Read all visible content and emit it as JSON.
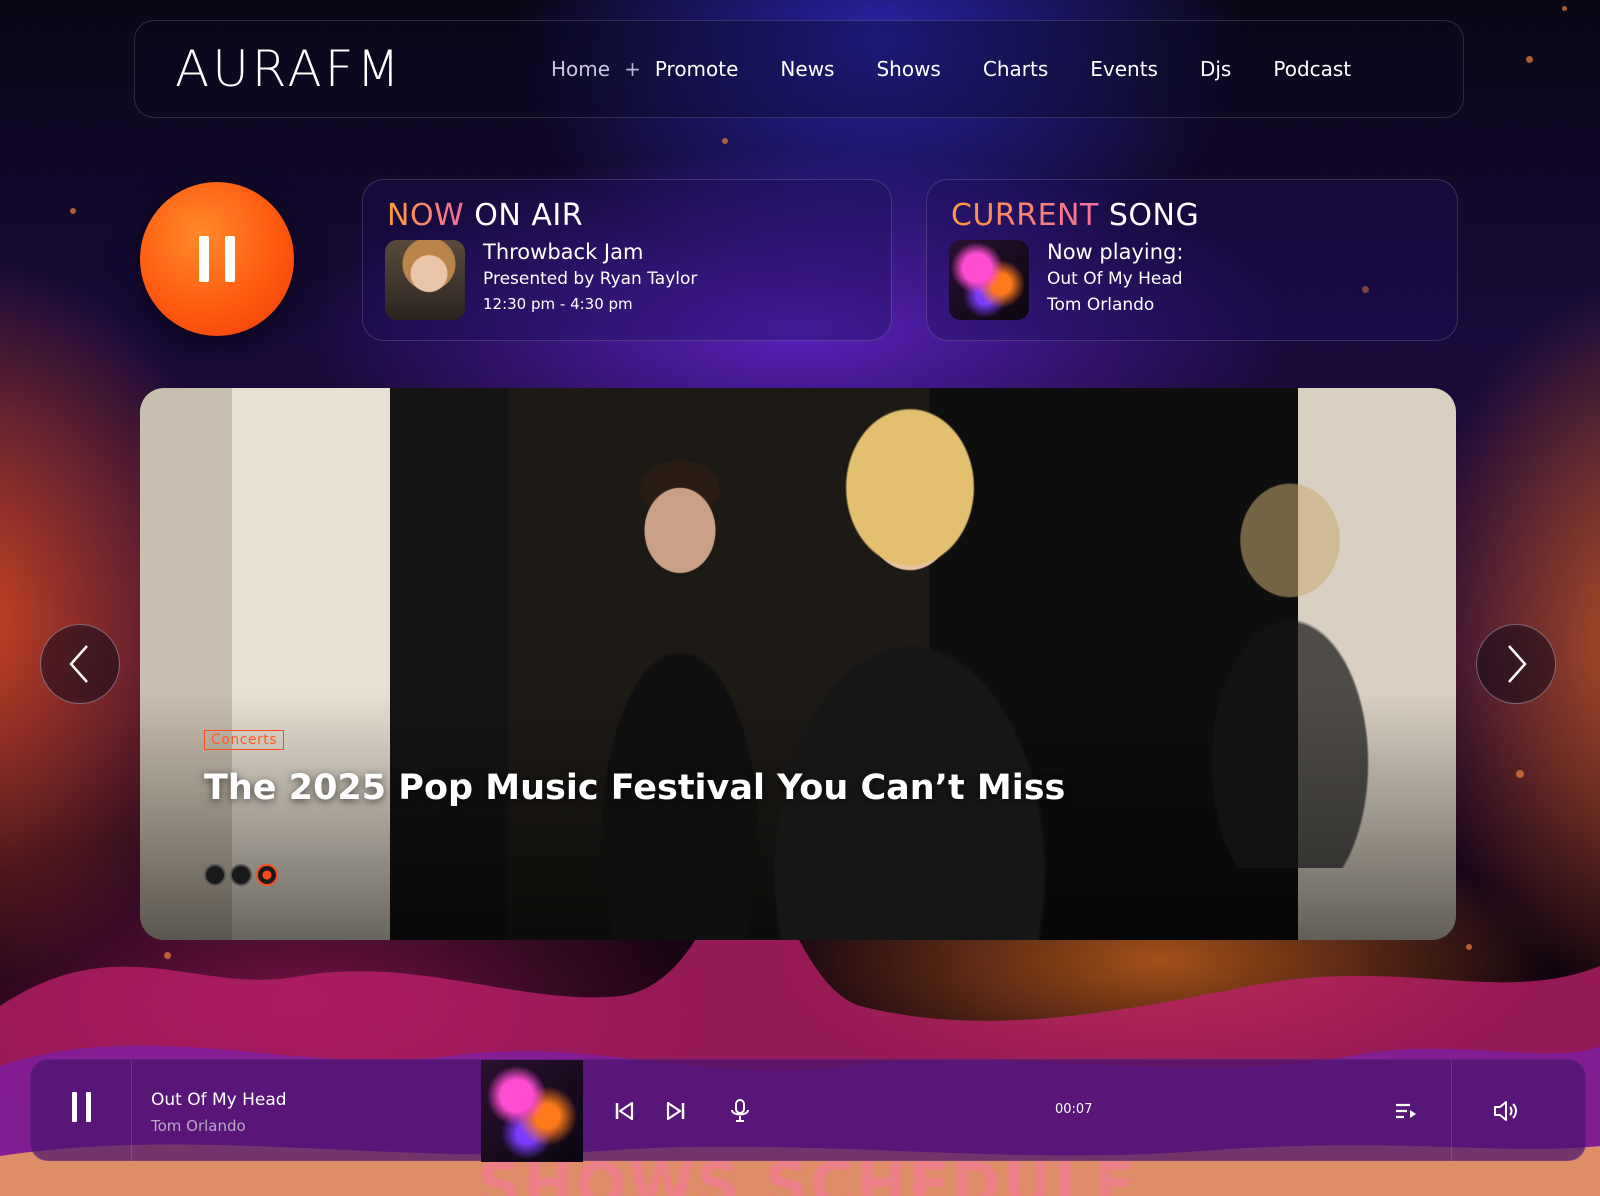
{
  "brand": {
    "logo": "AURAFM",
    "accent": "#ff5a10"
  },
  "nav": {
    "items": [
      {
        "label": "Home",
        "active": true
      },
      {
        "label": "Promote"
      },
      {
        "label": "News"
      },
      {
        "label": "Shows"
      },
      {
        "label": "Charts"
      },
      {
        "label": "Events"
      },
      {
        "label": "Djs"
      },
      {
        "label": "Podcast"
      }
    ],
    "plus_icon": "plus-icon"
  },
  "play_button": {
    "icon": "pause-icon",
    "state": "playing"
  },
  "on_air": {
    "title_accent": "NOW",
    "title_rest": " ON AIR",
    "show_name": "Throwback Jam",
    "presenter": "Presented by Ryan Taylor",
    "time": "12:30 pm - 4:30 pm"
  },
  "current_song": {
    "title_accent": "CURRENT",
    "title_rest": " SONG",
    "label": "Now playing:",
    "song": "Out Of My Head",
    "artist": "Tom Orlando"
  },
  "hero": {
    "tag": "Concerts",
    "headline": "The 2025 Pop Music Festival You Can’t Miss",
    "slide_count": 3,
    "active_slide": 3
  },
  "player": {
    "song": "Out Of My Head",
    "artist": "Tom Orlando",
    "time": "00:07",
    "icons": [
      "pause-icon",
      "skip-back-icon",
      "skip-forward-icon",
      "microphone-icon",
      "playlist-icon",
      "volume-icon"
    ]
  },
  "schedule_heading": "SHOWS SCHEDULE"
}
